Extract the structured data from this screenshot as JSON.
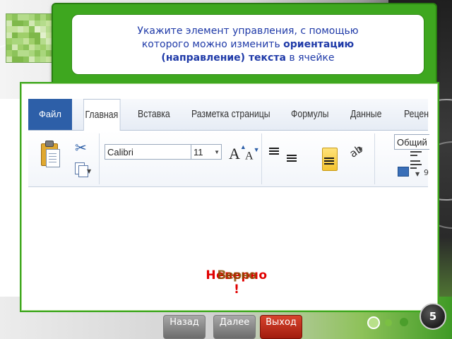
{
  "header": {
    "line1": "Укажите элемент управления, с помощью",
    "line2_pre": "которого можно изменить ",
    "line2_bold": "ориентацию",
    "line3_bold": "(направление) текста",
    "line3_post": " в ячейке"
  },
  "ribbon": {
    "tabs": [
      {
        "label": "Файл"
      },
      {
        "label": "Главная"
      },
      {
        "label": "Вставка"
      },
      {
        "label": "Разметка страницы"
      },
      {
        "label": "Формулы"
      },
      {
        "label": "Данные"
      },
      {
        "label": "Рецен"
      }
    ],
    "font_name": "Calibri",
    "font_size": "11",
    "grow_font_label": "A",
    "shrink_font_label": "A",
    "number_format": "Общий",
    "merge_extra": "9"
  },
  "feedback": {
    "wrong": "Неверно",
    "right": "Верно",
    "exclamation": "!"
  },
  "nav": {
    "back": "Назад",
    "next": "Далее",
    "exit": "Выход"
  },
  "slide_number": "5",
  "colors": {
    "accent_green": "#3ea71f",
    "header_text": "#1f3aa8",
    "feedback_red": "#e10000",
    "exit_red": "#a11c0e",
    "ribbon_blue": "#2d5fa8"
  },
  "icons": [
    "paste-icon",
    "scissors-icon",
    "copy-icon",
    "grow-font-icon",
    "shrink-font-icon",
    "align-top-icon",
    "align-middle-icon",
    "align-bottom-icon",
    "orientation-icon",
    "wrap-text-icon",
    "merge-icon"
  ]
}
